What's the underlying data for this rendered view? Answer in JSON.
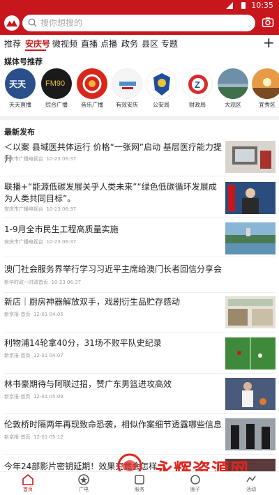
{
  "status_bar": {
    "time": "10:35"
  },
  "search": {
    "placeholder": "搜你想搜的"
  },
  "tabs": [
    "推荐",
    "安庆号",
    "微视频",
    "直播",
    "点播",
    "政务",
    "县区",
    "专题"
  ],
  "active_tab": "安庆号",
  "media_section_title": "媒体号推荐",
  "media_accounts": [
    {
      "label": "天天直播",
      "color": "#2a4f8a"
    },
    {
      "label": "综合广播",
      "color": "#1a1a1a"
    },
    {
      "label": "音乐广播",
      "color": "#d9261c"
    },
    {
      "label": "有效安庆",
      "color": "#f5f5f5"
    },
    {
      "label": "公安局",
      "color": "#1d4e9e"
    },
    {
      "label": "财政局",
      "color": "#d92b2b"
    },
    {
      "label": "大观区",
      "color": "#6d8fa8"
    },
    {
      "label": "宜秀区",
      "color": "#e89b46"
    }
  ],
  "latest_title": "最新发布",
  "news": [
    {
      "title": "＜以案 县域医共体运行 价格“一张网”启动 基层医疗能力提升",
      "source": "安庆市广播电视台",
      "time": "10-23 06:37",
      "has_thumb": true
    },
    {
      "title": "联播+“能源低碳发展关乎人类未来”“绿色低碳循环发展成为人类共同目标”。",
      "source": "安庆市广播电视台",
      "time": "10-23 06:37",
      "has_thumb": true
    },
    {
      "title": "1-9月全市民生工程高质量实施",
      "source": "安庆市广播电视台",
      "time": "10-23 06:37",
      "has_thumb": true
    },
    {
      "title": "澳门社会服务界举行学习习近平主席给澳门长者回信分享会",
      "source": "新华时政一时政首页",
      "time": "10-23 06:37",
      "has_thumb": false
    },
    {
      "title": "新店｜厨房神器解放双手，戏剧衍生品贮存感动",
      "source": "新京报-首页",
      "time": "12-01 04:05",
      "has_thumb": true
    },
    {
      "title": "利物浦14轮拿40分，31场不败平队史纪录",
      "source": "新京报-首页",
      "time": "12-01 04:07",
      "has_thumb": true
    },
    {
      "title": "林书豪期待与阿联过招，赞广东男篮进攻高效",
      "source": "新京报-首页",
      "time": "12-01 05:09",
      "has_thumb": true
    },
    {
      "title": "伦敦桥时隔两年再现致命恐袭，相似作案细节透露哪些信息",
      "source": "新京报-首页",
      "time": "12-01 05:12",
      "has_thumb": true
    },
    {
      "title": "今年24部影片密钥延期！效果究竟会怎样",
      "source": "",
      "time": "",
      "has_thumb": true
    }
  ],
  "bottom_nav": [
    {
      "label": "首页",
      "icon": "home-icon",
      "active": true
    },
    {
      "label": "广电",
      "icon": "broadcast-icon",
      "active": false
    },
    {
      "label": "服务",
      "icon": "service-icon",
      "active": false
    },
    {
      "label": "圈子",
      "icon": "circle-icon",
      "active": false
    },
    {
      "label": "活动",
      "icon": "activity-icon",
      "active": false
    }
  ],
  "watermark": {
    "text": "永辉资源网",
    "url": "www.yhkjjj.com"
  }
}
